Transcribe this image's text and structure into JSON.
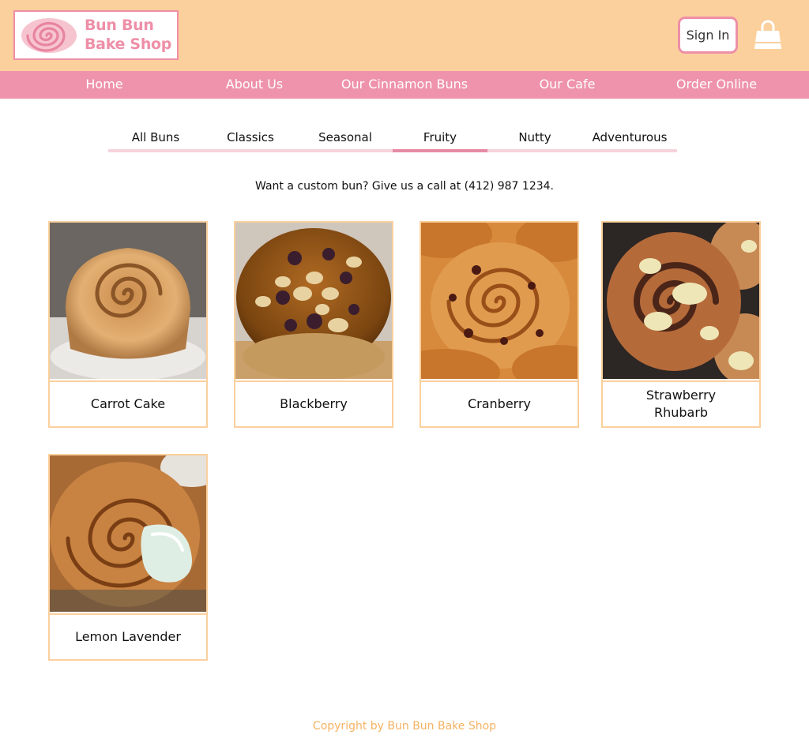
{
  "header": {
    "logo_line1": "Bun Bun",
    "logo_line2": "Bake Shop",
    "signin_label": "Sign In",
    "cart_icon": "shopping-bag-icon"
  },
  "nav": {
    "items": [
      {
        "label": "Home"
      },
      {
        "label": "About Us"
      },
      {
        "label": "Our Cinnamon Buns"
      },
      {
        "label": "Our Cafe"
      },
      {
        "label": "Order Online"
      }
    ]
  },
  "tabs": {
    "items": [
      {
        "label": "All Buns"
      },
      {
        "label": "Classics"
      },
      {
        "label": "Seasonal"
      },
      {
        "label": "Fruity"
      },
      {
        "label": "Nutty"
      },
      {
        "label": "Adventurous"
      }
    ],
    "active": "Fruity"
  },
  "promo": {
    "text": "Want a custom bun? Give us a call at  (412) 987 1234."
  },
  "products": [
    {
      "name": "Carrot Cake"
    },
    {
      "name": "Blackberry"
    },
    {
      "name": "Cranberry"
    },
    {
      "name": "Strawberry Rhubarb"
    },
    {
      "name": "Lemon Lavender"
    }
  ],
  "footer": {
    "copyright": "Copyright by Bun Bun Bake Shop"
  },
  "colors": {
    "header_bg": "#fbd09d",
    "nav_bg": "#ee93ab",
    "accent_pink": "#ee8fa7",
    "footer_text": "#f5b262"
  }
}
